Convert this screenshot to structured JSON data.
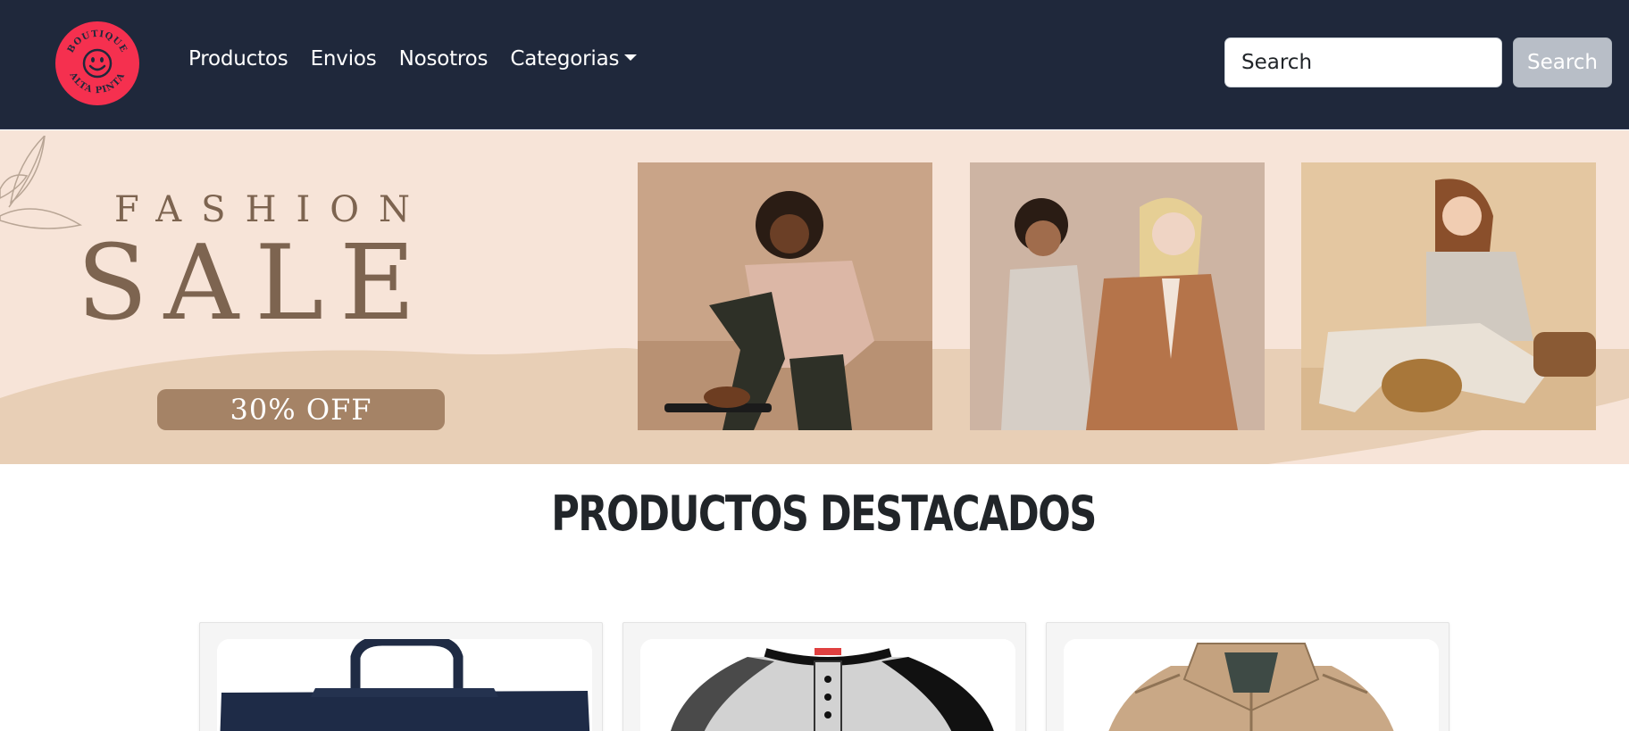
{
  "navbar": {
    "logo_text_top": "BOUTIQUE",
    "logo_text_bottom": "ALTA PINTA",
    "links": [
      {
        "label": "Productos"
      },
      {
        "label": "Envios"
      },
      {
        "label": "Nosotros"
      },
      {
        "label": "Categorias",
        "has_dropdown": true
      }
    ],
    "search": {
      "placeholder": "Search",
      "button_label": "Search"
    },
    "icons": {
      "logo": "smiley-logo-icon",
      "dropdown": "caret-down-icon"
    }
  },
  "banner": {
    "title_small": "FASHION",
    "title_big": "SALE",
    "discount": "30% OFF"
  },
  "featured": {
    "title": "PRODUCTOS DESTACADOS",
    "products": [
      {
        "name": "bag",
        "icon": "tote-bag-image"
      },
      {
        "name": "shirt",
        "icon": "raglan-shirt-image"
      },
      {
        "name": "jacket",
        "icon": "jacket-image"
      }
    ]
  },
  "colors": {
    "navbar_bg": "#1f283b",
    "logo_bg": "#f5304f",
    "banner_bg": "#f7e4d8",
    "banner_text": "#7d6450",
    "discount_bg": "#a58366"
  }
}
